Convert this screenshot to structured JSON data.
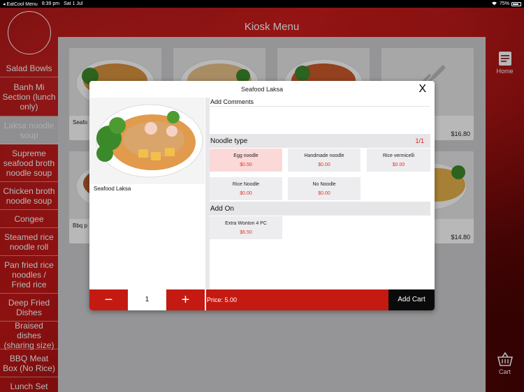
{
  "status_bar": {
    "back_app": "◂ EatCool Menu",
    "time": "8:39 pm",
    "date": "Sat 1 Jul",
    "battery": "75%"
  },
  "header": {
    "title": "Kiosk Menu"
  },
  "sidebar": {
    "items": [
      {
        "label": "Salad Bowls"
      },
      {
        "label": "Banh Mi Section (lunch only)"
      },
      {
        "label": "Laksa noodle soup"
      },
      {
        "label": "Supreme seafood broth noodle soup"
      },
      {
        "label": "Chicken broth noodle soup"
      },
      {
        "label": "Congee"
      },
      {
        "label": "Steamed rice noodle roll"
      },
      {
        "label": "Pan fried rice noodles / Fried rice"
      },
      {
        "label": "Deep Fried Dishes"
      },
      {
        "label": "Braised dishes (sharing size)"
      },
      {
        "label": "BBQ Meat Box (No Rice)"
      },
      {
        "label": "Lunch Set"
      }
    ]
  },
  "right_nav": {
    "home_label": "Home",
    "cart_label": "Cart"
  },
  "grid": {
    "cards": [
      {
        "name": "Seafo",
        "price": ""
      },
      {
        "name": "",
        "price": ""
      },
      {
        "name": "",
        "price": ""
      },
      {
        "name": "a",
        "price": "$16.80"
      },
      {
        "name": "Bbq p",
        "price": ""
      },
      {
        "name": "aksa",
        "price": "$14.80"
      }
    ]
  },
  "modal": {
    "title": "Seafood Laksa",
    "close_label": "X",
    "dish_name": "Seafood Laksa",
    "comments_label": "Add Comments",
    "noodle_type": {
      "label": "Noodle type",
      "count": "1/1",
      "options": [
        {
          "name": "Egg noodle",
          "price": "$0.50",
          "selected": true
        },
        {
          "name": "Handmade noodle",
          "price": "$0.00",
          "selected": false
        },
        {
          "name": "Rice vermicelli",
          "price": "$0.00",
          "selected": false
        },
        {
          "name": "Rice Noodle",
          "price": "$0.00",
          "selected": false
        },
        {
          "name": "No Noodle",
          "price": "$0.00",
          "selected": false
        }
      ]
    },
    "add_on": {
      "label": "Add On",
      "options": [
        {
          "name": "Extra Wonton 4 PC",
          "price": "$6.50"
        }
      ]
    },
    "quantity": {
      "minus": "−",
      "value": "1",
      "plus": "+"
    },
    "price_label": "Price: 5.00",
    "add_cart_label": "Add Cart"
  },
  "colors": {
    "accent": "#c41a12",
    "price_red": "#e2342c",
    "selected_bg": "#fbd9d9"
  }
}
